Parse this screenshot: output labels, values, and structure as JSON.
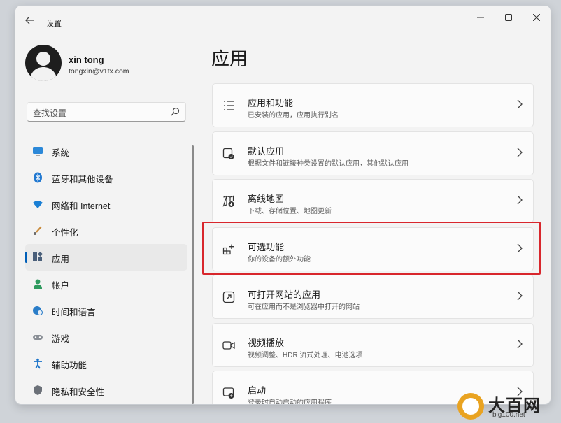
{
  "window": {
    "title": "设置",
    "back_icon": "back-arrow-icon",
    "controls": [
      "minimize-icon",
      "maximize-icon",
      "close-icon"
    ]
  },
  "user": {
    "name": "xin tong",
    "email": "tongxin@v1tx.com"
  },
  "search": {
    "placeholder": "查找设置",
    "icon": "search-icon"
  },
  "nav": {
    "items": [
      {
        "label": "系统",
        "icon": "system-display-icon",
        "selected": false
      },
      {
        "label": "蓝牙和其他设备",
        "icon": "bluetooth-icon",
        "selected": false
      },
      {
        "label": "网络和 Internet",
        "icon": "wifi-icon",
        "selected": false
      },
      {
        "label": "个性化",
        "icon": "brush-icon",
        "selected": false
      },
      {
        "label": "应用",
        "icon": "apps-icon",
        "selected": true
      },
      {
        "label": "帐户",
        "icon": "account-icon",
        "selected": false
      },
      {
        "label": "时间和语言",
        "icon": "globe-clock-icon",
        "selected": false
      },
      {
        "label": "游戏",
        "icon": "gamepad-icon",
        "selected": false
      },
      {
        "label": "辅助功能",
        "icon": "accessibility-icon",
        "selected": false
      },
      {
        "label": "隐私和安全性",
        "icon": "shield-icon",
        "selected": false
      }
    ]
  },
  "page": {
    "title": "应用",
    "cards": [
      {
        "title": "应用和功能",
        "subtitle": "已安装的应用，应用执行别名",
        "icon": "list-icon"
      },
      {
        "title": "默认应用",
        "subtitle": "根据文件和链接种类设置的默认应用，其他默认应用",
        "icon": "default-app-icon"
      },
      {
        "title": "离线地图",
        "subtitle": "下载、存储位置、地图更新",
        "icon": "map-download-icon"
      },
      {
        "title": "可选功能",
        "subtitle": "你的设备的额外功能",
        "icon": "add-feature-icon",
        "highlighted": true
      },
      {
        "title": "可打开网站的应用",
        "subtitle": "可在应用而不是浏览器中打开的网站",
        "icon": "open-external-icon"
      },
      {
        "title": "视频播放",
        "subtitle": "视频调整、HDR 流式处理、电池选项",
        "icon": "video-icon"
      },
      {
        "title": "启动",
        "subtitle": "登录时自动启动的应用程序",
        "icon": "startup-icon"
      }
    ]
  },
  "watermark": {
    "title": "大百网",
    "url": "big100.net"
  },
  "colors": {
    "accent": "#005fb8",
    "highlight_border": "#d8262c",
    "window_bg": "#f3f3f3",
    "card_bg": "#fbfbfb"
  }
}
